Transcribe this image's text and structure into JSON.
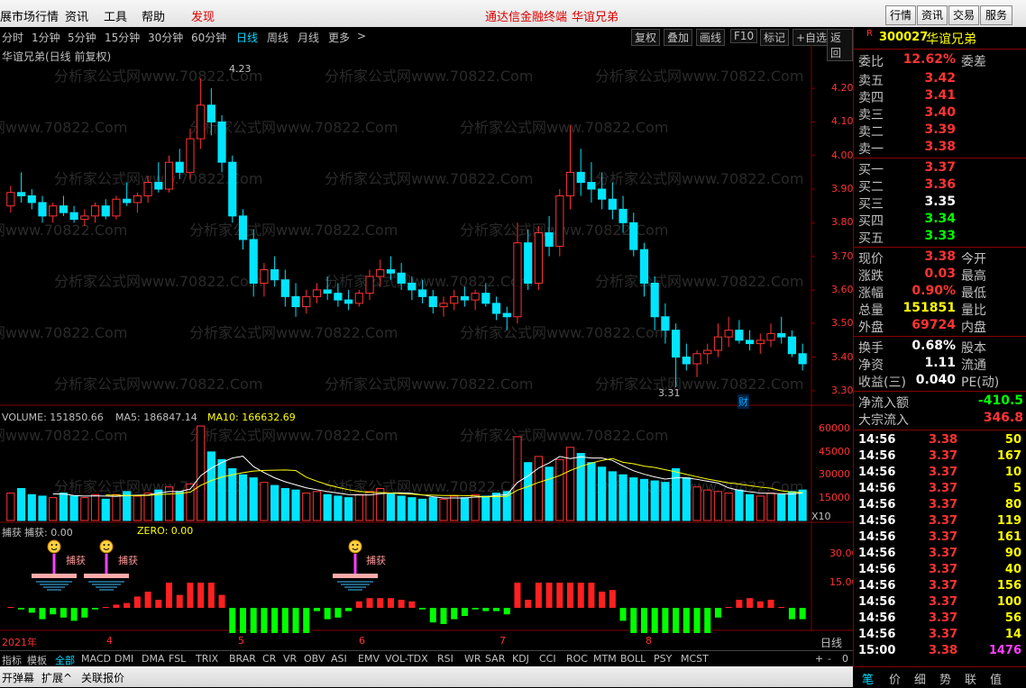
{
  "menu": {
    "items": [
      "展市场行情",
      "资讯",
      "工具",
      "帮助"
    ],
    "discover": "发现",
    "center_title": "通达信金融终端",
    "center_stock": "华谊兄弟",
    "right_buttons": [
      "行情",
      "资讯",
      "交易",
      "服务"
    ]
  },
  "toolbar": {
    "periods": [
      "分时",
      "1分钟",
      "5分钟",
      "15分钟",
      "30分钟",
      "60分钟",
      "日线",
      "周线",
      "月线",
      "更多"
    ],
    "active_period": "日线",
    "more_arrow": ">",
    "right_tools": [
      "复权",
      "叠加",
      "画线",
      "F10",
      "标记",
      "+自选",
      "返回"
    ]
  },
  "chart": {
    "title": "华谊兄弟(日线 前复权)",
    "watermark": "分析家公式网www.70822.Com",
    "high_label": "4.23",
    "low_label": "3.31",
    "cai_badge": "财",
    "yaxis_price": [
      "4.20",
      "4.10",
      "4.00",
      "3.90",
      "3.80",
      "3.70",
      "3.60",
      "3.50",
      "3.40",
      "3.30"
    ],
    "volume_header": {
      "volume": "VOLUME: 151850.66",
      "ma5": "MA5: 186847.14",
      "ma10": "MA10: 166632.69"
    },
    "yaxis_volume": [
      "60000",
      "45000",
      "30000",
      "15000"
    ],
    "volume_unit": "X10",
    "indicator_header": {
      "name": "捕获",
      "value": "捕获: 0.00",
      "zero": "ZERO: 0.00"
    },
    "yaxis_indicator": [
      "30.00",
      "15.00"
    ],
    "capture_label": "捕获",
    "xaxis_labels": [
      "2021年",
      "4",
      "5",
      "6",
      "7",
      "8"
    ],
    "period_label": "日线",
    "scroll_controls": [
      "+",
      "-",
      "0"
    ]
  },
  "chart_data": {
    "type": "candlestick",
    "title": "华谊兄弟(日线 前复权)",
    "y_price_range": [
      3.27,
      4.27
    ],
    "y_volume_range": [
      0,
      65000
    ],
    "candles": [
      [
        3.85,
        3.91,
        3.83,
        3.89
      ],
      [
        3.89,
        3.95,
        3.86,
        3.88
      ],
      [
        3.88,
        3.9,
        3.84,
        3.86
      ],
      [
        3.86,
        3.88,
        3.8,
        3.82
      ],
      [
        3.82,
        3.86,
        3.8,
        3.85
      ],
      [
        3.85,
        3.88,
        3.82,
        3.83
      ],
      [
        3.83,
        3.85,
        3.8,
        3.81
      ],
      [
        3.81,
        3.84,
        3.79,
        3.82
      ],
      [
        3.82,
        3.86,
        3.8,
        3.85
      ],
      [
        3.85,
        3.87,
        3.81,
        3.82
      ],
      [
        3.82,
        3.88,
        3.81,
        3.87
      ],
      [
        3.87,
        3.92,
        3.85,
        3.86
      ],
      [
        3.86,
        3.89,
        3.83,
        3.88
      ],
      [
        3.88,
        3.94,
        3.86,
        3.92
      ],
      [
        3.92,
        3.98,
        3.89,
        3.9
      ],
      [
        3.9,
        4.0,
        3.89,
        3.98
      ],
      [
        3.98,
        4.02,
        3.93,
        3.95
      ],
      [
        3.95,
        4.08,
        3.93,
        4.05
      ],
      [
        4.05,
        4.23,
        4.02,
        4.15
      ],
      [
        4.15,
        4.2,
        4.06,
        4.1
      ],
      [
        4.1,
        4.12,
        3.95,
        3.98
      ],
      [
        3.98,
        4.0,
        3.8,
        3.82
      ],
      [
        3.82,
        3.84,
        3.72,
        3.75
      ],
      [
        3.75,
        3.78,
        3.58,
        3.62
      ],
      [
        3.62,
        3.68,
        3.58,
        3.66
      ],
      [
        3.66,
        3.7,
        3.61,
        3.63
      ],
      [
        3.63,
        3.66,
        3.55,
        3.58
      ],
      [
        3.58,
        3.62,
        3.52,
        3.55
      ],
      [
        3.55,
        3.6,
        3.53,
        3.58
      ],
      [
        3.58,
        3.62,
        3.56,
        3.6
      ],
      [
        3.6,
        3.64,
        3.57,
        3.59
      ],
      [
        3.59,
        3.62,
        3.55,
        3.57
      ],
      [
        3.57,
        3.6,
        3.54,
        3.56
      ],
      [
        3.56,
        3.6,
        3.55,
        3.59
      ],
      [
        3.59,
        3.66,
        3.57,
        3.64
      ],
      [
        3.64,
        3.69,
        3.61,
        3.66
      ],
      [
        3.66,
        3.7,
        3.63,
        3.65
      ],
      [
        3.65,
        3.68,
        3.6,
        3.62
      ],
      [
        3.62,
        3.64,
        3.57,
        3.6
      ],
      [
        3.6,
        3.63,
        3.56,
        3.58
      ],
      [
        3.58,
        3.6,
        3.53,
        3.55
      ],
      [
        3.55,
        3.58,
        3.52,
        3.56
      ],
      [
        3.56,
        3.6,
        3.54,
        3.58
      ],
      [
        3.58,
        3.61,
        3.55,
        3.57
      ],
      [
        3.57,
        3.6,
        3.54,
        3.59
      ],
      [
        3.59,
        3.62,
        3.55,
        3.56
      ],
      [
        3.56,
        3.58,
        3.51,
        3.53
      ],
      [
        3.53,
        3.55,
        3.48,
        3.52
      ],
      [
        3.52,
        3.8,
        3.5,
        3.74
      ],
      [
        3.74,
        3.78,
        3.6,
        3.62
      ],
      [
        3.62,
        3.79,
        3.6,
        3.77
      ],
      [
        3.77,
        3.82,
        3.7,
        3.73
      ],
      [
        3.73,
        3.9,
        3.7,
        3.88
      ],
      [
        3.88,
        4.09,
        3.84,
        3.95
      ],
      [
        3.95,
        4.02,
        3.88,
        3.92
      ],
      [
        3.92,
        3.98,
        3.86,
        3.9
      ],
      [
        3.9,
        3.95,
        3.84,
        3.87
      ],
      [
        3.87,
        3.92,
        3.81,
        3.84
      ],
      [
        3.84,
        3.88,
        3.77,
        3.8
      ],
      [
        3.8,
        3.83,
        3.7,
        3.72
      ],
      [
        3.72,
        3.74,
        3.58,
        3.62
      ],
      [
        3.62,
        3.64,
        3.48,
        3.52
      ],
      [
        3.52,
        3.56,
        3.44,
        3.48
      ],
      [
        3.48,
        3.5,
        3.31,
        3.4
      ],
      [
        3.4,
        3.44,
        3.36,
        3.38
      ],
      [
        3.38,
        3.42,
        3.34,
        3.41
      ],
      [
        3.41,
        3.44,
        3.38,
        3.42
      ],
      [
        3.42,
        3.5,
        3.4,
        3.46
      ],
      [
        3.46,
        3.52,
        3.43,
        3.48
      ],
      [
        3.48,
        3.51,
        3.44,
        3.45
      ],
      [
        3.45,
        3.48,
        3.42,
        3.44
      ],
      [
        3.44,
        3.47,
        3.41,
        3.45
      ],
      [
        3.45,
        3.5,
        3.43,
        3.47
      ],
      [
        3.47,
        3.52,
        3.44,
        3.46
      ],
      [
        3.46,
        3.48,
        3.4,
        3.41
      ],
      [
        3.41,
        3.44,
        3.36,
        3.38
      ]
    ],
    "volumes": [
      18,
      21,
      17,
      16,
      15,
      18,
      16,
      15,
      17,
      14,
      17,
      19,
      16,
      18,
      20,
      22,
      19,
      24,
      62,
      45,
      40,
      34,
      30,
      28,
      25,
      23,
      21,
      20,
      18,
      19,
      17,
      16,
      15,
      17,
      19,
      21,
      18,
      16,
      15,
      14,
      15,
      14,
      16,
      15,
      17,
      16,
      18,
      19,
      55,
      38,
      42,
      35,
      40,
      48,
      44,
      38,
      35,
      32,
      30,
      28,
      27,
      26,
      25,
      34,
      28,
      22,
      20,
      19,
      18,
      20,
      17,
      16,
      18,
      17,
      19,
      20
    ],
    "ma5_volume": "186847.14",
    "ma10_volume": "166632.69"
  },
  "quote": {
    "code": "300027",
    "name": "华谊兄弟",
    "r_badge": "R",
    "weibi_label": "委比",
    "weibi_value": "12.62%",
    "weicha_label": "委差",
    "sells": [
      {
        "label": "卖五",
        "price": "3.42"
      },
      {
        "label": "卖四",
        "price": "3.41"
      },
      {
        "label": "卖三",
        "price": "3.40"
      },
      {
        "label": "卖二",
        "price": "3.39"
      },
      {
        "label": "卖一",
        "price": "3.38"
      }
    ],
    "buys": [
      {
        "label": "买一",
        "price": "3.37"
      },
      {
        "label": "买二",
        "price": "3.36"
      },
      {
        "label": "买三",
        "price": "3.35"
      },
      {
        "label": "买四",
        "price": "3.34"
      },
      {
        "label": "买五",
        "price": "3.33"
      }
    ],
    "stats": [
      {
        "k": "现价",
        "v": "3.38",
        "k2": "今开"
      },
      {
        "k": "涨跌",
        "v": "0.03",
        "k2": "最高"
      },
      {
        "k": "涨幅",
        "v": "0.90%",
        "k2": "最低"
      },
      {
        "k": "总量",
        "v": "151851",
        "k2": "量比"
      },
      {
        "k": "外盘",
        "v": "69724",
        "k2": "内盘"
      }
    ],
    "stats2": [
      {
        "k": "换手",
        "v": "0.68%",
        "k2": "股本"
      },
      {
        "k": "净资",
        "v": "1.11",
        "k2": "流通"
      },
      {
        "k": "收益(三)",
        "v": "0.040",
        "k2": "PE(动)"
      }
    ],
    "flows": [
      {
        "k": "净流入额",
        "v": "-410.5"
      },
      {
        "k": "大宗流入",
        "v": "346.8"
      }
    ],
    "ticks": [
      {
        "t": "14:56",
        "p": "3.38",
        "q": "50"
      },
      {
        "t": "14:56",
        "p": "3.37",
        "q": "167"
      },
      {
        "t": "14:56",
        "p": "3.37",
        "q": "10"
      },
      {
        "t": "14:56",
        "p": "3.37",
        "q": "5"
      },
      {
        "t": "14:56",
        "p": "3.37",
        "q": "80"
      },
      {
        "t": "14:56",
        "p": "3.37",
        "q": "119"
      },
      {
        "t": "14:56",
        "p": "3.37",
        "q": "161"
      },
      {
        "t": "14:56",
        "p": "3.37",
        "q": "90"
      },
      {
        "t": "14:56",
        "p": "3.37",
        "q": "40"
      },
      {
        "t": "14:56",
        "p": "3.37",
        "q": "156"
      },
      {
        "t": "14:56",
        "p": "3.37",
        "q": "100"
      },
      {
        "t": "14:56",
        "p": "3.37",
        "q": "56"
      },
      {
        "t": "14:56",
        "p": "3.37",
        "q": "14"
      },
      {
        "t": "15:00",
        "p": "3.38",
        "q": "1476"
      }
    ],
    "panel_tabs": [
      "笔",
      "价",
      "细",
      "势",
      "联",
      "值"
    ]
  },
  "indicator_tabs": {
    "lead": [
      "指标",
      "模板",
      "全部"
    ],
    "items": [
      "MACD",
      "DMI",
      "DMA",
      "FSL",
      "TRIX",
      "BRAR",
      "CR",
      "VR",
      "OBV",
      "ASI",
      "EMV",
      "VOL-TDX",
      "RSI",
      "WR",
      "SAR",
      "KDJ",
      "CCI",
      "ROC",
      "MTM",
      "BOLL",
      "PSY",
      "MCST"
    ]
  },
  "bottom": {
    "items": [
      "开弹幕",
      "扩展^",
      "关联报价"
    ]
  },
  "colors": {
    "up": "#ff3333",
    "down": "#00e5ff",
    "ma5": "#ffffff",
    "ma10": "#ffff00",
    "grid": "#800000"
  }
}
